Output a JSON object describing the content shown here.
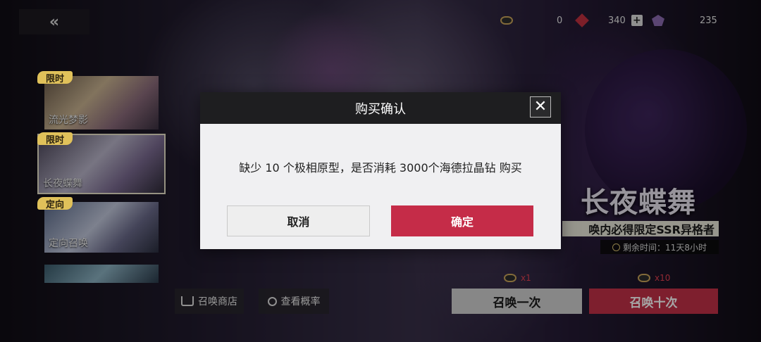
{
  "topbar": {
    "back_label": "«",
    "resources": [
      {
        "icon": "eye-token-icon",
        "value": "0"
      },
      {
        "icon": "red-gem-icon",
        "value": "340",
        "has_plus": true
      },
      {
        "icon": "crystal-icon",
        "value": "235"
      }
    ],
    "plus_label": "+"
  },
  "banners": [
    {
      "tag": "限时",
      "title": "流光梦影"
    },
    {
      "tag": "限时",
      "title": "长夜蝶舞",
      "selected": true
    },
    {
      "tag": "定向",
      "title": "定向召唤"
    },
    {
      "tag": "",
      "title": ""
    }
  ],
  "banner_info": {
    "name": "长夜蝶舞",
    "subtitle": "唤内必得限定SSR异格者",
    "time_left": "剩余时间：11天8小时"
  },
  "bottom": {
    "shop_label": "召唤商店",
    "rates_label": "查看概率",
    "summon_once_label": "召唤一次",
    "summon_ten_label": "召唤十次",
    "cost_once": "x1",
    "cost_ten": "x10"
  },
  "dialog": {
    "title": "购买确认",
    "close_label": "✕",
    "message": "缺少 10 个极相原型，是否消耗 3000个海德拉晶钻 购买",
    "cancel_label": "取消",
    "confirm_label": "确定"
  },
  "colors": {
    "accent_red": "#c52c48",
    "tag_gold": "#e0c15a"
  }
}
